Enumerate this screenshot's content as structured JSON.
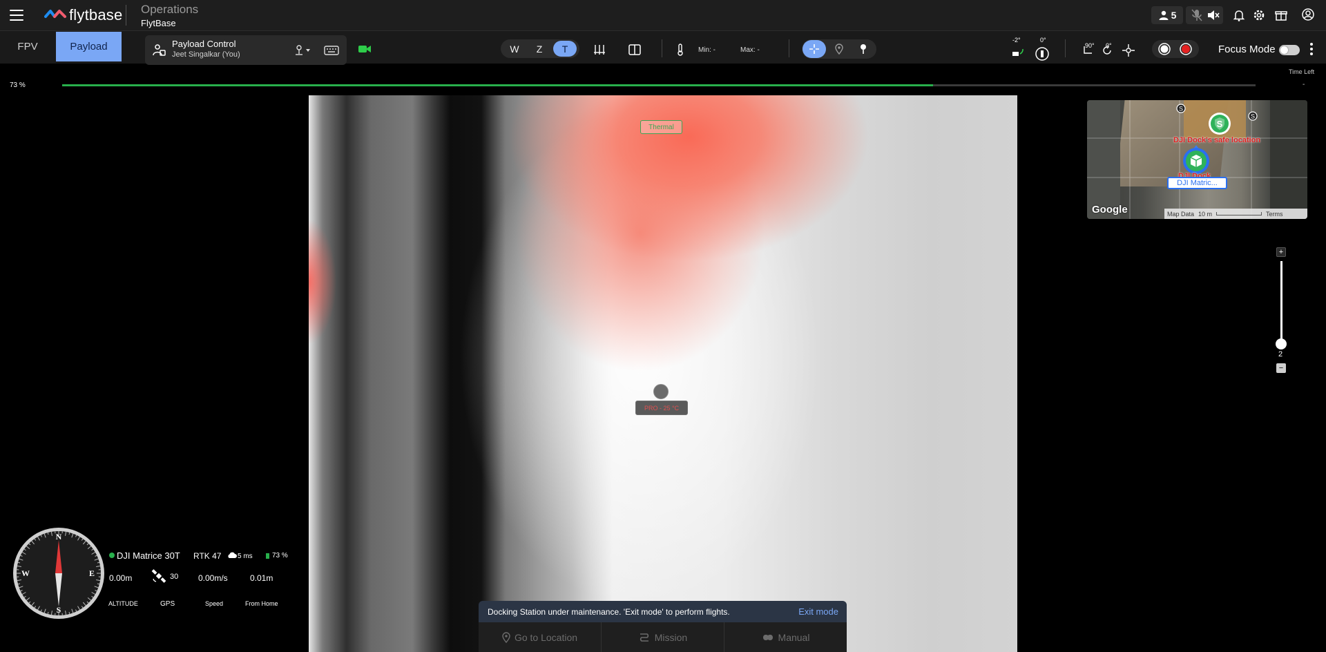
{
  "header": {
    "logo_text": "flytbase",
    "title": "Operations",
    "subtitle": "FlytBase",
    "users_count": "5",
    "icons": [
      "menu-icon",
      "users-icon",
      "mic-off-icon",
      "speaker-mute-icon",
      "bell-icon",
      "gear-icon",
      "gift-icon",
      "profile-icon"
    ]
  },
  "controls": {
    "tabs": {
      "fpv": "FPV",
      "payload": "Payload"
    },
    "active_tab": "Payload",
    "payload_card": {
      "title": "Payload Control",
      "user": "Jeet Singalkar (You)"
    },
    "camera_modes": {
      "w": "W",
      "z": "Z",
      "t": "T"
    },
    "active_camera_mode": "T",
    "temperature": {
      "min": "Min: -",
      "max": "Max: -"
    },
    "gimbal": {
      "pitch": "-2°",
      "yaw": "0°"
    },
    "angles": {
      "a90": "90°",
      "a0": "0°"
    },
    "focus_mode_label": "Focus Mode",
    "focus_mode_on": false,
    "accent_color": "#7aa7f5"
  },
  "status": {
    "battery_percent_label": "73 %",
    "progress_fraction": 0.73,
    "time_left_label": "Time Left",
    "time_left_value": "-"
  },
  "feed": {
    "thermal_tag": "Thermal",
    "spot_label": "PRO - 25 °C"
  },
  "map": {
    "safe_location_label": "DJI Dock's safe location",
    "dock_label": "DJI Dock",
    "drone_label": "DJI Matric...",
    "google": "Google",
    "map_data": "Map Data",
    "scale": "10 m",
    "terms": "Terms"
  },
  "zoom": {
    "value": "2",
    "plus": "+",
    "minus": "−"
  },
  "telemetry": {
    "compass": {
      "n": "N",
      "s": "S",
      "e": "E",
      "w": "W"
    },
    "drone_name": "DJI Matrice 30T",
    "rtk": "RTK 47",
    "latency": "5 ms",
    "battery": "73 %",
    "altitude": "0.00m",
    "gps_count": "30",
    "speed": "0.00m/s",
    "from_home": "0.01m",
    "labels": {
      "altitude": "ALTITUDE",
      "gps": "GPS",
      "speed": "Speed",
      "from_home": "From Home"
    },
    "status_color": "#28b04c"
  },
  "bottom": {
    "notice": "Docking Station under maintenance. 'Exit mode' to perform flights.",
    "exit": "Exit mode",
    "tabs": {
      "goto": "Go to Location",
      "mission": "Mission",
      "manual": "Manual"
    }
  }
}
